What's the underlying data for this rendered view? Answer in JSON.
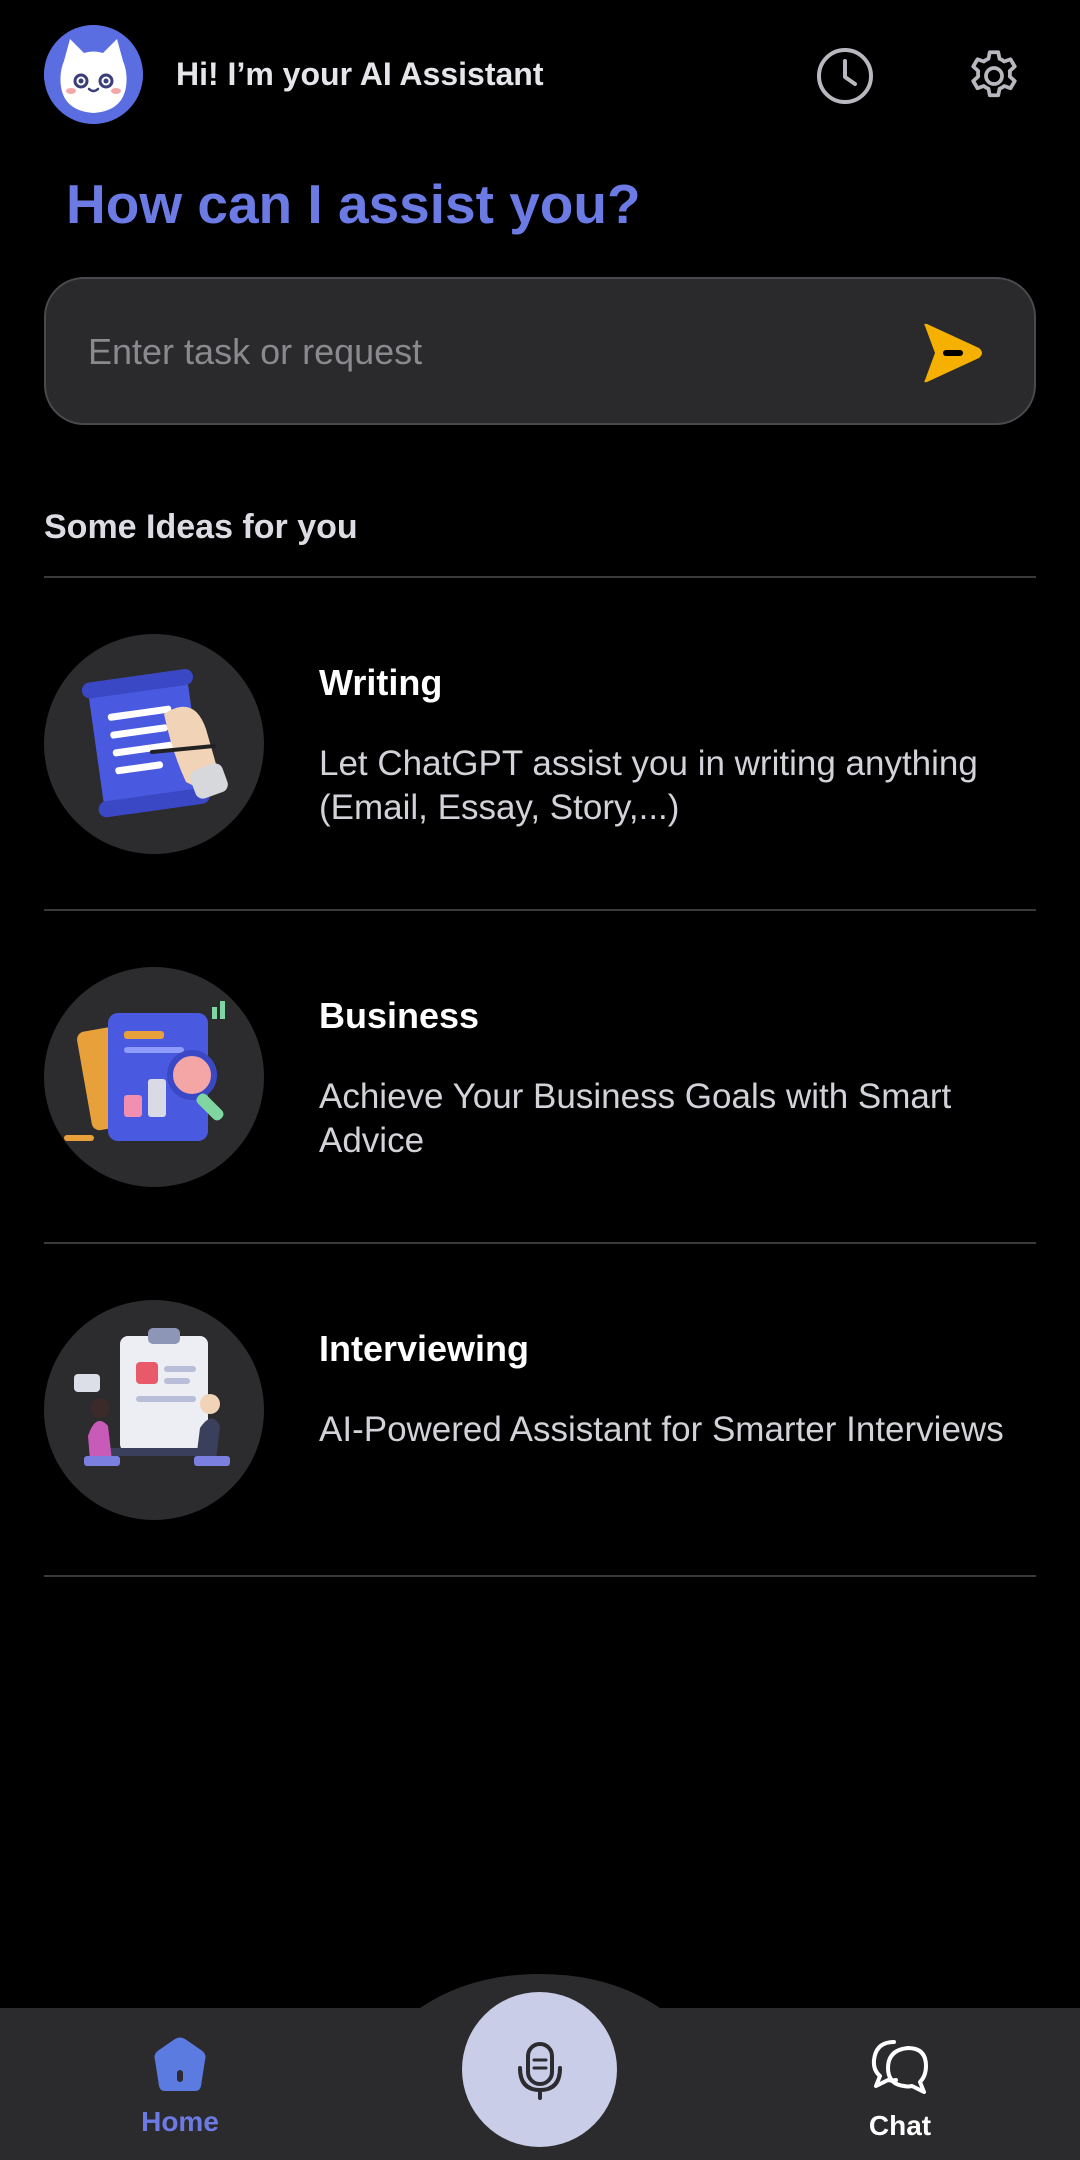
{
  "header": {
    "greeting": "Hi! I’m your AI Assistant",
    "avatar_icon": "cat-face-icon",
    "history_icon": "clock-icon",
    "settings_icon": "gear-icon"
  },
  "headline": "How can I assist you?",
  "search": {
    "placeholder": "Enter task or request",
    "value": "",
    "send_icon": "send-arrow-icon"
  },
  "ideas_section": {
    "title": "Some Ideas for you",
    "items": [
      {
        "title": "Writing",
        "description": "Let ChatGPT assist you in writing anything (Email, Essay, Story,...)",
        "icon": "scroll-writing-icon"
      },
      {
        "title": "Business",
        "description": "Achieve Your Business Goals with Smart Advice",
        "icon": "business-chart-icon"
      },
      {
        "title": "Interviewing",
        "description": "AI-Powered Assistant for Smarter Interviews",
        "icon": "interview-meeting-icon"
      }
    ]
  },
  "bottom_nav": {
    "home_label": "Home",
    "chat_label": "Chat",
    "mic_icon": "microphone-icon"
  },
  "colors": {
    "accent": "#6b7be3",
    "send": "#f5b000",
    "nav_bg": "#2b2b2d",
    "mic_bg": "#c9cde8"
  }
}
